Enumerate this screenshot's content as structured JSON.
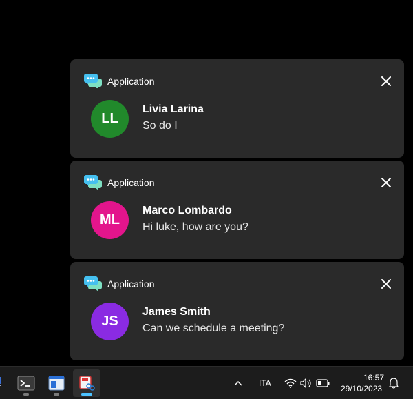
{
  "notifications": [
    {
      "app_name": "Application",
      "initials": "LL",
      "avatar_color": "#21892b",
      "sender": "Livia Larina",
      "message": "So do I"
    },
    {
      "app_name": "Application",
      "initials": "ML",
      "avatar_color": "#e3158c",
      "sender": "Marco Lombardo",
      "message": "Hi luke, how are you?"
    },
    {
      "app_name": "Application",
      "initials": "JS",
      "avatar_color": "#8a2be2",
      "sender": "James Smith",
      "message": "Can we schedule a meeting?"
    }
  ],
  "taskbar": {
    "apps": [
      "terminal-icon",
      "window-icon",
      "snipping-tool-icon"
    ],
    "language": "ITA",
    "time": "16:57",
    "date": "29/10/2023"
  },
  "colors": {
    "toast_bg": "#2a2a2a",
    "taskbar_bg": "#1c1c1c",
    "accent": "#4cc2ff"
  }
}
